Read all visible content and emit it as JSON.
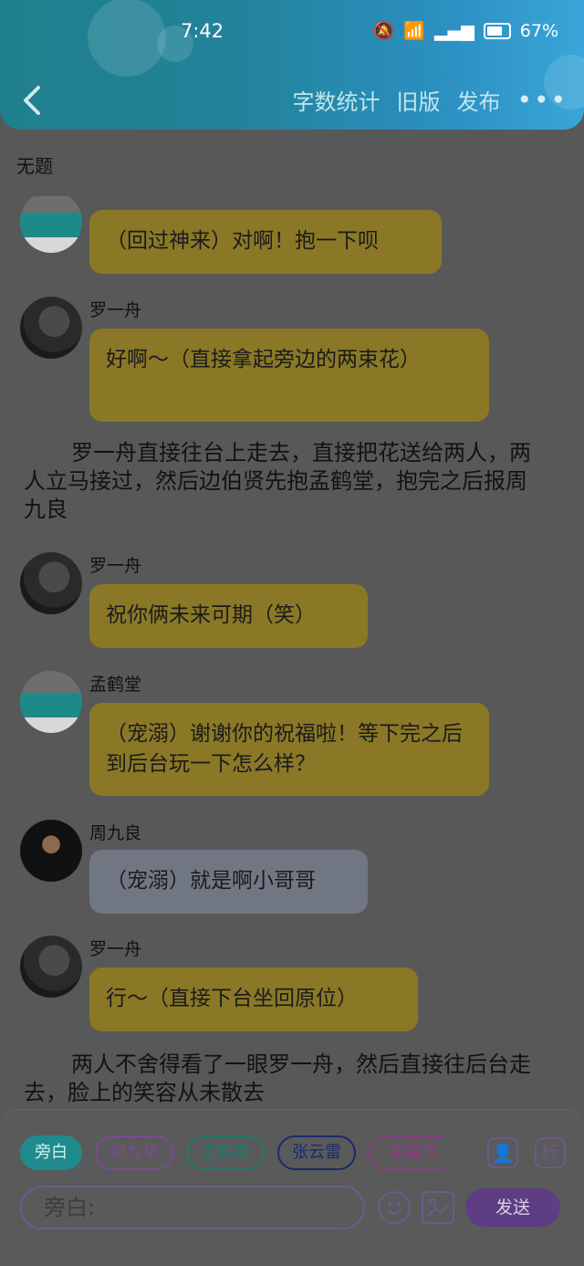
{
  "status": {
    "time": "7:42",
    "battery": "67%"
  },
  "header": {
    "menu": [
      "字数统计",
      "旧版",
      "发布"
    ]
  },
  "doc": {
    "title": "无题"
  },
  "messages": [
    {
      "sender": "",
      "text": "（回过神来）对啊！抱一下呗"
    },
    {
      "sender": "罗一舟",
      "text": "好啊～（直接拿起旁边的两束花）"
    },
    {
      "narration": "罗一舟直接往台上走去，直接把花送给两人，两人立马接过，然后边伯贤先抱孟鹤堂，抱完之后报周九良"
    },
    {
      "sender": "罗一舟",
      "text": "祝你俩未来可期（笑）"
    },
    {
      "sender": "孟鹤堂",
      "text": "（宠溺）谢谢你的祝福啦！等下完之后到后台玩一下怎么样？"
    },
    {
      "sender": "周九良",
      "text": "（宠溺）就是啊小哥哥"
    },
    {
      "sender": "罗一舟",
      "text": "行～（直接下台坐回原位）"
    },
    {
      "narration": "两人不舍得看了一眼罗一舟，然后直接往后台走去，脸上的笑容从未散去"
    }
  ],
  "roles": [
    "旁白",
    "何九华",
    "孟鹤堂",
    "张云雷",
    "秦霄贤"
  ],
  "input": {
    "placeholder": "旁白:"
  },
  "send_label": "发送",
  "tag_label": "标"
}
